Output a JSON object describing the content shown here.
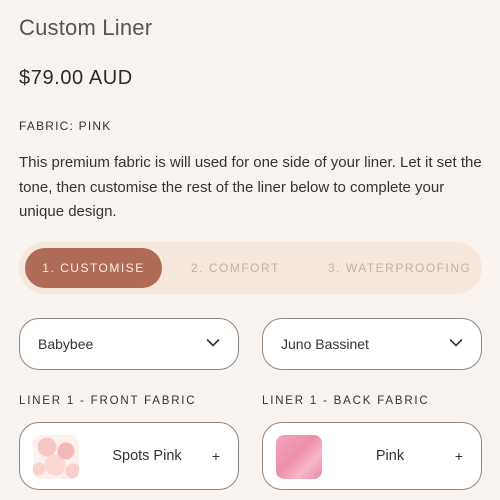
{
  "product": {
    "title": "Custom Liner",
    "price": "$79.00 AUD",
    "fabric_label": "FABRIC: PINK",
    "description": "This premium fabric is will used for one side of your liner. Let it set the tone, then customise the rest of the liner below to complete your unique design."
  },
  "steps": [
    {
      "label": "1. CUSTOMISE",
      "active": true
    },
    {
      "label": "2. COMFORT",
      "active": false
    },
    {
      "label": "3. WATERPROOFING",
      "active": false
    }
  ],
  "selects": [
    {
      "value": "Babybee",
      "icon": "chevron-down-icon"
    },
    {
      "value": "Juno Bassinet",
      "icon": "chevron-down-icon"
    }
  ],
  "fabrics": [
    {
      "section_label": "LINER 1 - FRONT FABRIC",
      "name": "Spots Pink",
      "action": "+",
      "swatch": "spots-pink"
    },
    {
      "section_label": "LINER 1 - BACK FABRIC",
      "name": "Pink",
      "action": "+",
      "swatch": "solid-pink"
    }
  ],
  "colors": {
    "background": "#f9f3ef",
    "accent": "#b06b55",
    "stepper_track": "#f5e7dc"
  }
}
